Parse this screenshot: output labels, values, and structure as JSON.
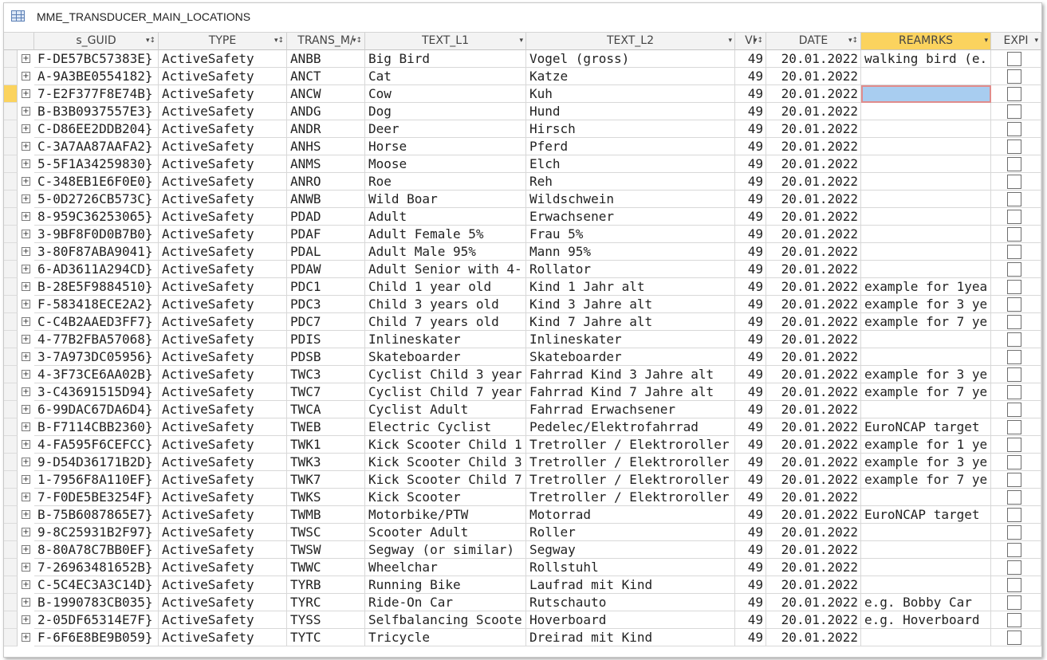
{
  "window": {
    "title": "MME_TRANSDUCER_MAIN_LOCATIONS"
  },
  "columns": [
    {
      "label": "s_GUID",
      "arrow": "▾↕"
    },
    {
      "label": "TYPE",
      "arrow": "▾↕"
    },
    {
      "label": "TRANS_M/",
      "arrow": "▾↕"
    },
    {
      "label": "TEXT_L1",
      "arrow": "▾"
    },
    {
      "label": "TEXT_L2",
      "arrow": "▾"
    },
    {
      "label": "VI",
      "arrow": "▾↕"
    },
    {
      "label": "DATE",
      "arrow": "▾↕"
    },
    {
      "label": "REAMRKS",
      "arrow": "▾"
    },
    {
      "label": "EXPI",
      "arrow": "▾"
    }
  ],
  "rows": [
    {
      "guid": "F-DE57BC57383E}",
      "type": "ActiveSafety",
      "code": "ANBB",
      "l1": "Big Bird",
      "l2": "Vogel (gross)",
      "vi": "49",
      "date": "20.01.2022",
      "remarks": "walking bird (e."
    },
    {
      "guid": "A-9A3BE0554182}",
      "type": "ActiveSafety",
      "code": "ANCT",
      "l1": "Cat",
      "l2": "Katze",
      "vi": "49",
      "date": "20.01.2022",
      "remarks": ""
    },
    {
      "guid": "7-E2F377F8E74B}",
      "type": "ActiveSafety",
      "code": "ANCW",
      "l1": "Cow",
      "l2": "Kuh",
      "vi": "49",
      "date": "20.01.2022",
      "remarks": ""
    },
    {
      "guid": "B-B3B0937557E3}",
      "type": "ActiveSafety",
      "code": "ANDG",
      "l1": "Dog",
      "l2": "Hund",
      "vi": "49",
      "date": "20.01.2022",
      "remarks": ""
    },
    {
      "guid": "C-D86EE2DDB204}",
      "type": "ActiveSafety",
      "code": "ANDR",
      "l1": "Deer",
      "l2": "Hirsch",
      "vi": "49",
      "date": "20.01.2022",
      "remarks": ""
    },
    {
      "guid": "C-3A7AA87AAFA2}",
      "type": "ActiveSafety",
      "code": "ANHS",
      "l1": "Horse",
      "l2": "Pferd",
      "vi": "49",
      "date": "20.01.2022",
      "remarks": ""
    },
    {
      "guid": "5-5F1A34259830}",
      "type": "ActiveSafety",
      "code": "ANMS",
      "l1": "Moose",
      "l2": "Elch",
      "vi": "49",
      "date": "20.01.2022",
      "remarks": ""
    },
    {
      "guid": "C-348EB1E6F0E0}",
      "type": "ActiveSafety",
      "code": "ANRO",
      "l1": "Roe",
      "l2": "Reh",
      "vi": "49",
      "date": "20.01.2022",
      "remarks": ""
    },
    {
      "guid": "5-0D2726CB573C}",
      "type": "ActiveSafety",
      "code": "ANWB",
      "l1": "Wild Boar",
      "l2": "Wildschwein",
      "vi": "49",
      "date": "20.01.2022",
      "remarks": ""
    },
    {
      "guid": "8-959C36253065}",
      "type": "ActiveSafety",
      "code": "PDAD",
      "l1": "Adult",
      "l2": "Erwachsener",
      "vi": "49",
      "date": "20.01.2022",
      "remarks": ""
    },
    {
      "guid": "3-9BF8F0D0B7B0}",
      "type": "ActiveSafety",
      "code": "PDAF",
      "l1": "Adult Female 5%",
      "l2": "Frau 5%",
      "vi": "49",
      "date": "20.01.2022",
      "remarks": ""
    },
    {
      "guid": "3-80F87ABA9041}",
      "type": "ActiveSafety",
      "code": "PDAL",
      "l1": "Adult Male 95%",
      "l2": "Mann 95%",
      "vi": "49",
      "date": "20.01.2022",
      "remarks": ""
    },
    {
      "guid": "6-AD3611A294CD}",
      "type": "ActiveSafety",
      "code": "PDAW",
      "l1": "Adult Senior with 4-",
      "l2": "Rollator",
      "vi": "49",
      "date": "20.01.2022",
      "remarks": ""
    },
    {
      "guid": "B-28E5F9884510}",
      "type": "ActiveSafety",
      "code": "PDC1",
      "l1": "Child 1 year old",
      "l2": "Kind 1 Jahr alt",
      "vi": "49",
      "date": "20.01.2022",
      "remarks": "example for 1yea"
    },
    {
      "guid": "F-583418ECE2A2}",
      "type": "ActiveSafety",
      "code": "PDC3",
      "l1": "Child 3 years old",
      "l2": "Kind 3 Jahre alt",
      "vi": "49",
      "date": "20.01.2022",
      "remarks": "example for 3 ye"
    },
    {
      "guid": "C-C4B2AAED3FF7}",
      "type": "ActiveSafety",
      "code": "PDC7",
      "l1": "Child 7 years old",
      "l2": "Kind 7 Jahre alt",
      "vi": "49",
      "date": "20.01.2022",
      "remarks": "example for 7 ye"
    },
    {
      "guid": "4-77B2FBA57068}",
      "type": "ActiveSafety",
      "code": "PDIS",
      "l1": "Inlineskater",
      "l2": "Inlineskater",
      "vi": "49",
      "date": "20.01.2022",
      "remarks": ""
    },
    {
      "guid": "3-7A973DC05956}",
      "type": "ActiveSafety",
      "code": "PDSB",
      "l1": "Skateboarder",
      "l2": "Skateboarder",
      "vi": "49",
      "date": "20.01.2022",
      "remarks": ""
    },
    {
      "guid": "4-3F73CE6AA02B}",
      "type": "ActiveSafety",
      "code": "TWC3",
      "l1": "Cyclist Child 3 year",
      "l2": "Fahrrad Kind 3 Jahre alt",
      "vi": "49",
      "date": "20.01.2022",
      "remarks": "example for 3 ye"
    },
    {
      "guid": "3-C43691515D94}",
      "type": "ActiveSafety",
      "code": "TWC7",
      "l1": "Cyclist Child 7 year",
      "l2": "Fahrrad Kind 7 Jahre alt",
      "vi": "49",
      "date": "20.01.2022",
      "remarks": "example for 7 ye"
    },
    {
      "guid": "6-99DAC67DA6D4}",
      "type": "ActiveSafety",
      "code": "TWCA",
      "l1": "Cyclist Adult",
      "l2": "Fahrrad Erwachsener",
      "vi": "49",
      "date": "20.01.2022",
      "remarks": ""
    },
    {
      "guid": "B-F7114CBB2360}",
      "type": "ActiveSafety",
      "code": "TWEB",
      "l1": "Electric Cyclist",
      "l2": "Pedelec/Elektrofahrrad",
      "vi": "49",
      "date": "20.01.2022",
      "remarks": "EuroNCAP target"
    },
    {
      "guid": "4-FA595F6CEFCC}",
      "type": "ActiveSafety",
      "code": "TWK1",
      "l1": "Kick Scooter Child 1",
      "l2": "Tretroller / Elektroroller",
      "vi": "49",
      "date": "20.01.2022",
      "remarks": "example for 1 ye"
    },
    {
      "guid": "9-D54D36171B2D}",
      "type": "ActiveSafety",
      "code": "TWK3",
      "l1": "Kick Scooter Child 3",
      "l2": "Tretroller / Elektroroller",
      "vi": "49",
      "date": "20.01.2022",
      "remarks": "example for 3 ye"
    },
    {
      "guid": "1-7956F8A110EF}",
      "type": "ActiveSafety",
      "code": "TWK7",
      "l1": "Kick Scooter Child 7",
      "l2": "Tretroller / Elektroroller",
      "vi": "49",
      "date": "20.01.2022",
      "remarks": "example for 7 ye"
    },
    {
      "guid": "7-F0DE5BE3254F}",
      "type": "ActiveSafety",
      "code": "TWKS",
      "l1": "Kick Scooter",
      "l2": "Tretroller / Elektroroller",
      "vi": "49",
      "date": "20.01.2022",
      "remarks": ""
    },
    {
      "guid": "B-75B6087865E7}",
      "type": "ActiveSafety",
      "code": "TWMB",
      "l1": "Motorbike/PTW",
      "l2": "Motorrad",
      "vi": "49",
      "date": "20.01.2022",
      "remarks": "EuroNCAP target"
    },
    {
      "guid": "9-8C25931B2F97}",
      "type": "ActiveSafety",
      "code": "TWSC",
      "l1": "Scooter Adult",
      "l2": "Roller",
      "vi": "49",
      "date": "20.01.2022",
      "remarks": ""
    },
    {
      "guid": "8-80A78C7BB0EF}",
      "type": "ActiveSafety",
      "code": "TWSW",
      "l1": "Segway (or similar)",
      "l2": "Segway",
      "vi": "49",
      "date": "20.01.2022",
      "remarks": ""
    },
    {
      "guid": "7-26963481652B}",
      "type": "ActiveSafety",
      "code": "TWWC",
      "l1": "Wheelchar",
      "l2": "Rollstuhl",
      "vi": "49",
      "date": "20.01.2022",
      "remarks": ""
    },
    {
      "guid": "C-5C4EC3A3C14D}",
      "type": "ActiveSafety",
      "code": "TYRB",
      "l1": "Running Bike",
      "l2": "Laufrad mit Kind",
      "vi": "49",
      "date": "20.01.2022",
      "remarks": ""
    },
    {
      "guid": "B-1990783CB035}",
      "type": "ActiveSafety",
      "code": "TYRC",
      "l1": "Ride-On Car",
      "l2": "Rutschauto",
      "vi": "49",
      "date": "20.01.2022",
      "remarks": "e.g. Bobby Car"
    },
    {
      "guid": "2-05DF65314E7F}",
      "type": "ActiveSafety",
      "code": "TYSS",
      "l1": "Selfbalancing Scoote",
      "l2": "Hoverboard",
      "vi": "49",
      "date": "20.01.2022",
      "remarks": "e.g. Hoverboard"
    },
    {
      "guid": "F-6F6E8BE9B059}",
      "type": "ActiveSafety",
      "code": "TYTC",
      "l1": "Tricycle",
      "l2": "Dreirad mit Kind",
      "vi": "49",
      "date": "20.01.2022",
      "remarks": ""
    }
  ],
  "current_row": 2,
  "active_column": "remarks",
  "colors": {
    "accent": "#fbd35e",
    "selection": "#a8cdf0",
    "grid": "#d8d8d8"
  },
  "icons": {
    "title": "table-icon",
    "expander": "expand-plus-icon",
    "header_arrow": "dropdown-arrow-icon"
  }
}
